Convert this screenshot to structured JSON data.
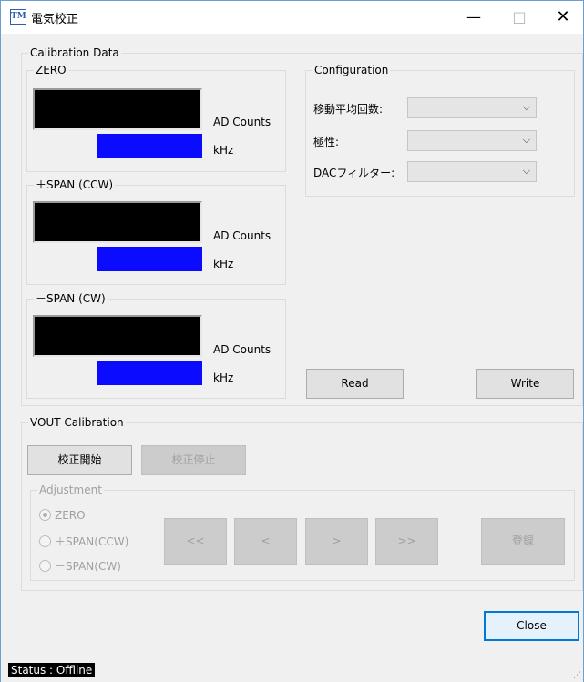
{
  "window": {
    "app_icon": "TM",
    "title": "電気校正",
    "minimize_glyph": "—",
    "maximize_glyph": "□",
    "close_glyph": "✕"
  },
  "calibration_data": {
    "label": "Calibration Data",
    "zero": {
      "label": "ZERO",
      "ad_unit": "AD Counts",
      "freq_unit": "kHz"
    },
    "span_ccw": {
      "label": "＋SPAN (CCW)",
      "ad_unit": "AD Counts",
      "freq_unit": "kHz"
    },
    "span_cw": {
      "label": "－SPAN (CW)",
      "ad_unit": "AD Counts",
      "freq_unit": "kHz"
    },
    "display_colors": {
      "ad": "#000000",
      "freq": "#0b0bff"
    }
  },
  "configuration": {
    "label": "Configuration",
    "moving_average_label": "移動平均回数:",
    "moving_average_value": "",
    "polarity_label": "極性:",
    "polarity_value": "",
    "dac_filter_label": "DACフィルター:",
    "dac_filter_value": "",
    "read_label": "Read",
    "write_label": "Write"
  },
  "vout": {
    "label": "VOUT Calibration",
    "start_label": "校正開始",
    "stop_label": "校正停止",
    "adjustment": {
      "label": "Adjustment",
      "options": [
        "ZERO",
        "＋SPAN(CCW)",
        "－SPAN(CW)"
      ],
      "selected": "ZERO",
      "fast_back_label": "<<",
      "back_label": "<",
      "forward_label": ">",
      "fast_forward_label": ">>",
      "register_label": "登録"
    }
  },
  "footer": {
    "close_label": "Close",
    "status": "Status : Offline"
  },
  "icons": [
    "chevron-down-icon",
    "minimize-icon",
    "maximize-icon",
    "close-icon",
    "resize-grip-icon"
  ]
}
